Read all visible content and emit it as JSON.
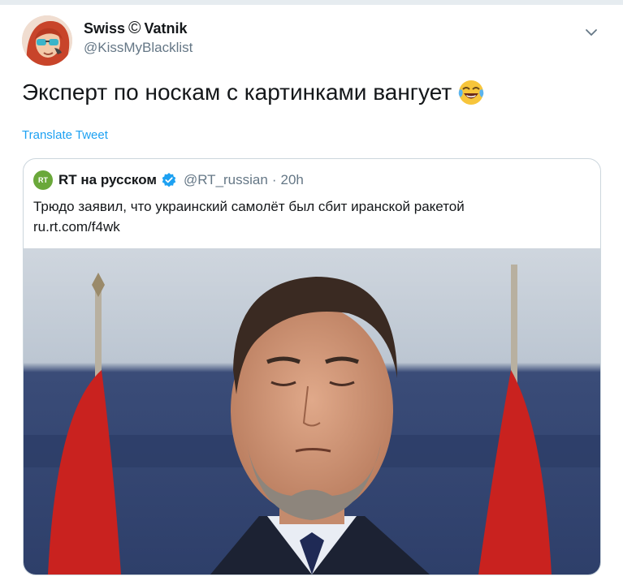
{
  "tweet": {
    "author": {
      "name_part1": "Swiss",
      "copyright_glyph": "©",
      "name_part2": "Vatnik",
      "handle": "@KissMyBlacklist"
    },
    "text": "Эксперт по носкам с картинками вангует",
    "emoji_icon": "face-with-tears-of-joy-icon",
    "translate_label": "Translate Tweet",
    "menu_icon": "chevron-down-icon"
  },
  "quote": {
    "logo_text": "RT",
    "name": "RT на русском",
    "verified_icon": "verified-badge-icon",
    "handle": "@RT_russian",
    "separator": "·",
    "time": "20h",
    "text_line1": "Трюдо заявил, что украинский самолёт был сбит иранской ракетой",
    "text_line2": "ru.rt.com/f4wk",
    "photo_icon": "press-conference-photo"
  },
  "colors": {
    "link": "#1da1f2",
    "secondary_text": "#657786",
    "border": "#ccd6dd",
    "verified": "#1da1f2",
    "rt_logo": "#6aa83a"
  }
}
